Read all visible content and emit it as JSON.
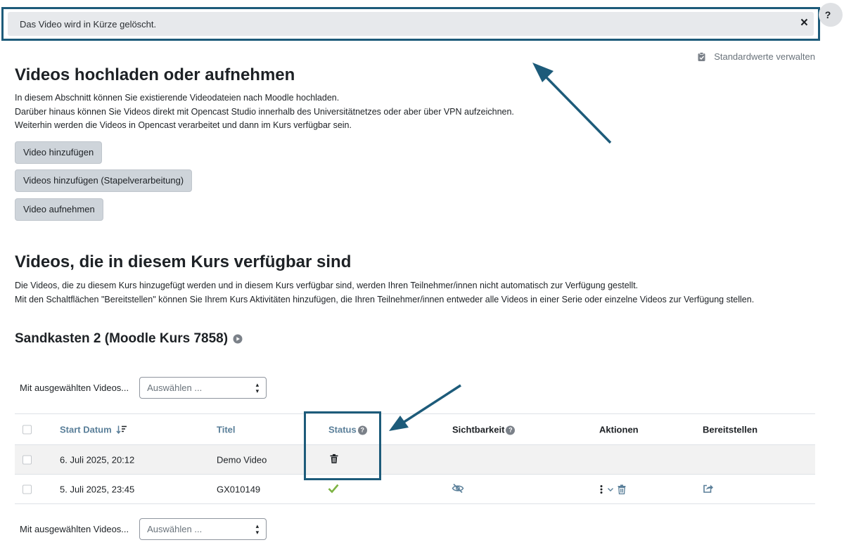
{
  "notification": {
    "message": "Das Video wird in Kürze gelöscht.",
    "close_label": "×"
  },
  "help_button": {
    "label": "?"
  },
  "standard_link": {
    "label": "Standardwerte verwalten"
  },
  "upload": {
    "title": "Videos hochladen oder aufnehmen",
    "lines": [
      "In diesem Abschnitt können Sie existierende Videodateien nach Moodle hochladen.",
      "Darüber hinaus können Sie Videos direkt mit Opencast Studio innerhalb des Universitätnetzes oder aber über VPN aufzeichnen.",
      "Weiterhin werden die Videos in Opencast verarbeitet und dann im Kurs verfügbar sein."
    ],
    "buttons": [
      "Video hinzufügen",
      "Videos hinzufügen (Stapelverarbeitung)",
      "Video aufnehmen"
    ]
  },
  "available": {
    "title": "Videos, die in diesem Kurs verfügbar sind",
    "lines": [
      "Die Videos, die zu diesem Kurs hinzugefügt werden und in diesem Kurs verfügbar sind, werden Ihren Teilnehmer/innen nicht automatisch zur Verfügung gestellt.",
      "Mit den Schaltflächen \"Bereitstellen\" können Sie Ihrem Kurs Aktivitäten hinzufügen, die Ihren Teilnehmer/innen entweder alle Videos in einer Serie oder einzelne Videos zur Verfügung stellen."
    ]
  },
  "course": {
    "title": "Sandkasten 2 (Moodle Kurs 7858)"
  },
  "bulk": {
    "label": "Mit ausgewählten Videos...",
    "select_value": "Auswählen ..."
  },
  "table": {
    "headers": {
      "date": "Start Datum",
      "title": "Titel",
      "status": "Status",
      "visibility": "Sichtbarkeit",
      "actions": "Aktionen",
      "share": "Bereitstellen"
    },
    "rows": [
      {
        "date": "6. Juli 2025, 20:12",
        "title": "Demo Video",
        "status": "trash-icon"
      },
      {
        "date": "5. Juli 2025, 23:45",
        "title": "GX010149",
        "status": "check-icon"
      }
    ]
  },
  "colors": {
    "annotation": "#1d5b7a",
    "success": "#7cb342",
    "link": "#5a7f99",
    "button_bg": "#ced4da"
  }
}
